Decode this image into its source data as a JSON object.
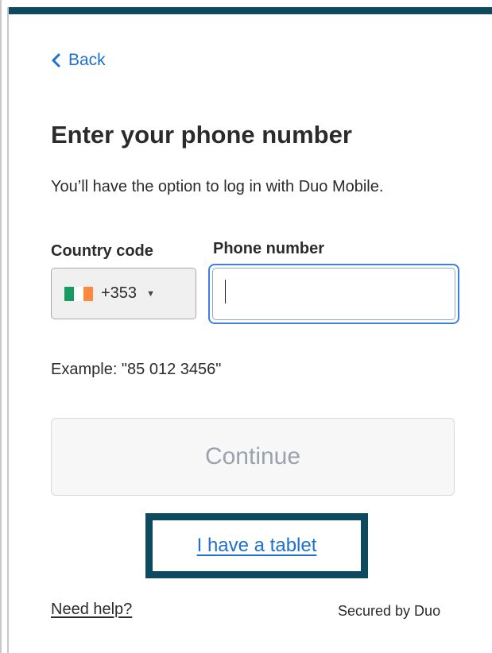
{
  "nav": {
    "back_label": "Back"
  },
  "header": {
    "title": "Enter your phone number",
    "subtitle": "You’ll have the option to log in with Duo Mobile."
  },
  "form": {
    "country_code_label": "Country code",
    "phone_number_label": "Phone number",
    "country_code_value": "+353",
    "country_flag": "ireland-flag",
    "phone_number_value": "",
    "example_text": "Example: \"85 012 3456\""
  },
  "actions": {
    "continue_label": "Continue",
    "tablet_link_label": "I have a tablet"
  },
  "footer": {
    "help_label": "Need help?",
    "secured_text": "Secured by Duo"
  },
  "colors": {
    "accent": "#0e4a5f",
    "link": "#1f6fd0",
    "focus": "#3d7fe0",
    "flag_green": "#169b62",
    "flag_white": "#ffffff",
    "flag_orange": "#ff883e"
  }
}
